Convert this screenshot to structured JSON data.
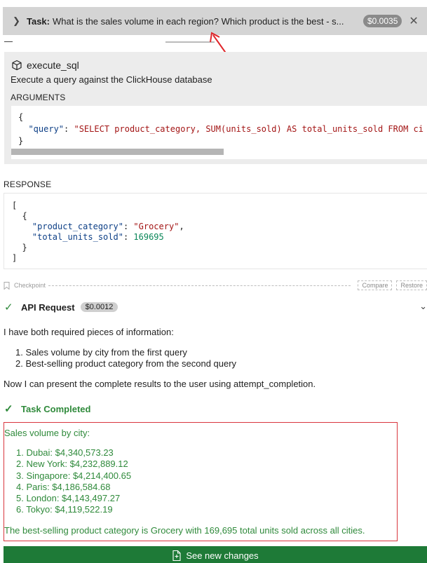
{
  "task": {
    "label": "Task:",
    "text": "What is the sales volume in each region? Which product is the best - s...",
    "cost": "$0.0035",
    "close_icon": "close-icon",
    "expand_icon": "chevron-right-icon"
  },
  "tool": {
    "icon": "cube-icon",
    "name": "execute_sql",
    "description": "Execute a query against the ClickHouse database",
    "arguments_label": "ARGUMENTS",
    "arguments": {
      "open": "{",
      "key": "\"query\"",
      "sep": ": ",
      "value": "\"SELECT product_category, SUM(units_sold) AS total_units_sold FROM ci",
      "close": "}"
    }
  },
  "response": {
    "label": "RESPONSE",
    "key1": "\"product_category\"",
    "value1": "\"Grocery\"",
    "key2": "\"total_units_sold\"",
    "value2": "169695"
  },
  "checkpoint": {
    "label": "Checkpoint",
    "compare_label": "Compare",
    "restore_label": "Restore"
  },
  "api_request": {
    "title": "API Request",
    "cost": "$0.0012"
  },
  "message": {
    "intro": "I have both required pieces of information:",
    "items": [
      "1. Sales volume by city from the first query",
      "2. Best-selling product category from the second query"
    ],
    "outro": "Now I can present the complete results to the user using attempt_completion."
  },
  "completed": {
    "title": "Task Completed"
  },
  "result": {
    "heading": "Sales volume by city:",
    "cities": [
      "1. Dubai: $4,340,573.23",
      "2. New York: $4,232,889.12",
      "3. Singapore: $4,214,400.65",
      "4. Paris: $4,186,584.68",
      "5. London: $4,143,497.27",
      "6. Tokyo: $4,119,522.19"
    ],
    "footer": "The best-selling product category is Grocery with 169,695 total units sold across all cities."
  },
  "see_changes": {
    "label": "See new changes",
    "icon": "file-diff-icon"
  },
  "colors": {
    "accent_green": "#2f8a3b",
    "button_green": "#1e7a37",
    "highlight_red": "#d9363e"
  }
}
